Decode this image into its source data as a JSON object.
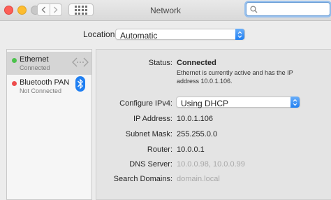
{
  "window": {
    "title": "Network"
  },
  "toolbar": {
    "back_icon": "chevron-left-icon",
    "forward_icon": "chevron-right-icon",
    "grid_icon": "grid-icon",
    "search_icon": "search-icon",
    "search_value": ""
  },
  "location": {
    "label": "Location:",
    "value": "Automatic"
  },
  "services": [
    {
      "name": "Ethernet",
      "status": "Connected",
      "dot_color": "#4cc24c",
      "icon": "ethernet-icon"
    },
    {
      "name": "Bluetooth PAN",
      "status": "Not Connected",
      "dot_color": "#ed4d4d",
      "icon": "bluetooth-icon"
    }
  ],
  "details": {
    "status_label": "Status:",
    "status_value": "Connected",
    "status_desc": "Ethernet is currently active and has the IP address 10.0.1.106.",
    "configure_label": "Configure IPv4:",
    "configure_value": "Using DHCP",
    "ip_label": "IP Address:",
    "ip_value": "10.0.1.106",
    "subnet_label": "Subnet Mask:",
    "subnet_value": "255.255.0.0",
    "router_label": "Router:",
    "router_value": "10.0.0.1",
    "dns_label": "DNS Server:",
    "dns_value": "10.0.0.98, 10.0.0.99",
    "search_domains_label": "Search Domains:",
    "search_domains_value": "domain.local"
  },
  "colors": {
    "accent": "#1f7ff2",
    "connected": "#4cc24c",
    "disconnected": "#ed4d4d"
  }
}
